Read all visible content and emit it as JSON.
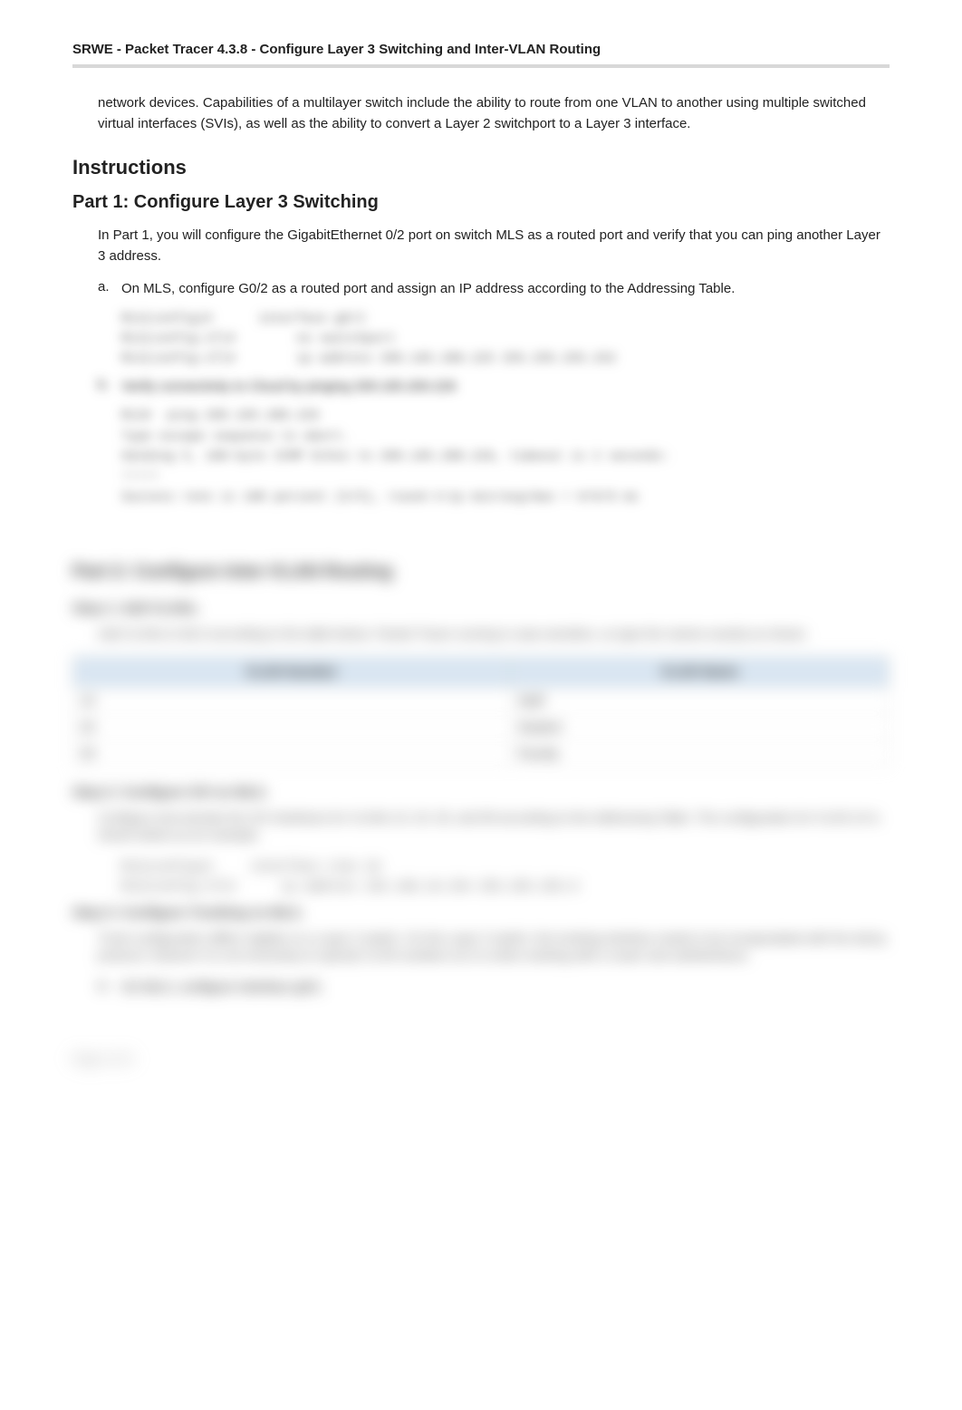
{
  "header": {
    "title": "SRWE - Packet Tracer 4.3.8 - Configure Layer 3 Switching and Inter-VLAN Routing"
  },
  "intro": "network devices. Capabilities of a multilayer switch include the ability to route from one VLAN to another using multiple switched virtual interfaces (SVIs), as well as the ability to convert a Layer 2 switchport to a Layer 3 interface.",
  "instructions_heading": "Instructions",
  "part1": {
    "heading": "Part 1: Configure Layer 3 Switching",
    "body": "In Part 1, you will configure the GigabitEthernet 0/2 port on switch MLS as a routed port and verify that you can ping another Layer 3 address.",
    "steps": [
      {
        "letter": "a.",
        "text": "On MLS, configure G0/2 as a routed port and assign an IP address according to the Addressing Table."
      },
      {
        "letter": "b.",
        "text": "Verify connectivity to   Cloud   by pinging 209.165.200.226"
      }
    ],
    "code1": [
      "MLS(config)#      interface g0/2",
      "MLS(config-if)#        no switchport",
      "MLS(config-if)#        ip address 209.165.200.225 255.255.255.252"
    ],
    "code2": [
      "MLS#  ping 209.165.200.226",
      "",
      "Type escape sequence to abort.",
      "Sending 5, 100-byte ICMP Echos to 209.165.200.226, timeout is 2 seconds:",
      "!!!!!",
      "Success rate is 100 percent (5/5), round-trip min/avg/max = 0/0/0 ms"
    ]
  },
  "part2": {
    "heading": "Part 2: Configure Inter-VLAN Routing",
    "step1": {
      "heading": "Step 1: Add VLANs.",
      "body": "Add VLANs to   MLS   according to the table below. Packet Tracer scoring is case-sensitive, so type the names exactly as shown.",
      "table_headers": [
        "VLAN Number",
        "VLAN Name"
      ],
      "table_rows": [
        [
          "10",
          "Staff"
        ],
        [
          "20",
          "Student"
        ],
        [
          "30",
          "Faculty"
        ]
      ]
    },
    "step2": {
      "heading": "Step 2: Configure SVI on MLS.",
      "body": "Configure and activate the SVI interfaces for VLANs 10, 20, 30, and 99 according to the Addressing Table. The configuration for VLAN 10 is shown below as an example.",
      "code": [
        "MLS(config)#     interface vlan 10",
        "MLS(config-if)#      ip address 192.168.10.254 255.255.255.0"
      ]
    },
    "step3": {
      "heading": "Step 3: Configure Trunking on MLS.",
      "body": "Trunk configuration differs slightly on a Layer 3 switch. On the Layer 3 switch, the trunking interface needs to be encapsulated with the dot1q protocol, however it is not necessary to specify VLAN numbers as it is when working with a router and subinterfaces.",
      "substep": {
        "letter": "a.",
        "text": "On MLS, configure interface     g0/1."
      }
    }
  },
  "footer": "Page 2 of 5"
}
